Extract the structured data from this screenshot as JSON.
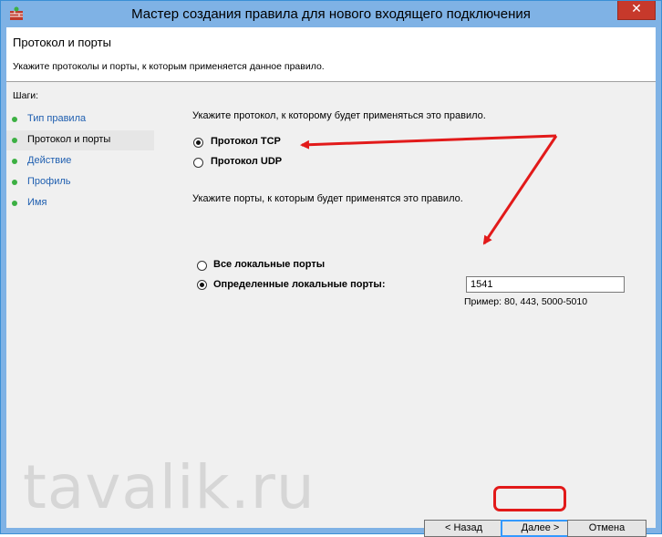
{
  "window": {
    "title": "Мастер создания правила для нового входящего подключения",
    "close_label": "✕"
  },
  "header": {
    "title": "Протокол и порты",
    "description": "Укажите протоколы и порты, к которым применяется данное правило."
  },
  "steps": {
    "label": "Шаги:",
    "items": [
      {
        "label": "Тип правила"
      },
      {
        "label": "Протокол и порты"
      },
      {
        "label": "Действие"
      },
      {
        "label": "Профиль"
      },
      {
        "label": "Имя"
      }
    ]
  },
  "main": {
    "protocol_prompt": "Укажите протокол, к которому будет применяться это правило.",
    "protocol_tcp": "Протокол TCP",
    "protocol_udp": "Протокол UDP",
    "protocol_selected": "TCP",
    "ports_prompt": "Укажите порты, к которым будет применятся это правило.",
    "all_ports": "Все локальные порты",
    "specific_ports": "Определенные локальные порты:",
    "ports_selected": "specific",
    "port_value": "1541",
    "port_example": "Пример: 80, 443, 5000-5010"
  },
  "buttons": {
    "back": "< Назад",
    "next": "Далее >",
    "cancel": "Отмена"
  },
  "watermark": "tavalik.ru",
  "colors": {
    "titlebar": "#7fb2e5",
    "close": "#c7392b",
    "annotation": "#e21a1a",
    "step_dot": "#3cb043",
    "step_link": "#1f5fb0"
  }
}
